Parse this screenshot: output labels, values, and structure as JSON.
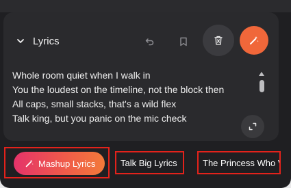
{
  "header": {
    "title": "Lyrics"
  },
  "actions": {
    "undo_icon": "undo-icon",
    "bookmark_icon": "bookmark-icon",
    "delete_icon": "trash-icon",
    "magic_icon": "magic-wand-icon",
    "accent_color": "#f0673a"
  },
  "lyrics": {
    "lines": [
      "Whole room quiet when I walk in",
      "You the loudest on the timeline, not the block then",
      "All caps, small stacks, that's a wild flex",
      "Talk king, but you panic on the mic check"
    ]
  },
  "chips": [
    {
      "label": "Mashup Lyrics"
    },
    {
      "label": "Talk Big Lyrics"
    },
    {
      "label": "The Princess Who V"
    }
  ],
  "highlight_color": "#e3221b"
}
